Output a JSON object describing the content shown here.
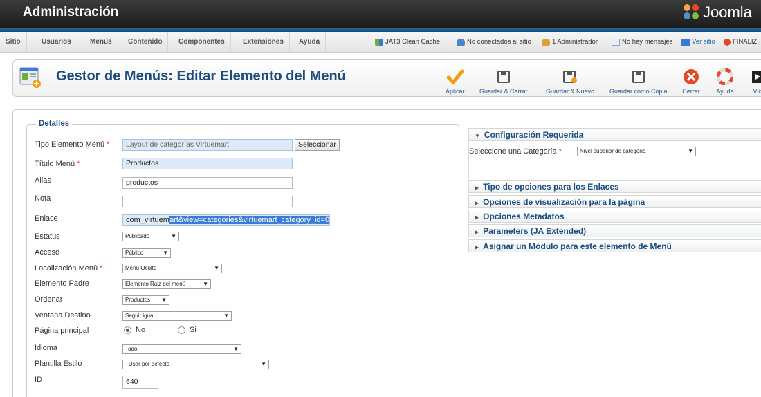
{
  "header": {
    "title": "Administración",
    "brand": "Joomla"
  },
  "menubar": {
    "items": [
      "Sitio",
      "Usuarios",
      "Menús",
      "Contenido",
      "Componentes",
      "Extensiones",
      "Ayuda"
    ],
    "status": {
      "cache": "JAT3 Clean Cache",
      "visitors": "No conectados al sitio",
      "admins": "1 Administrador",
      "messages": "No hay mensajes",
      "view_site": "Ver sitio",
      "logout": "FINALIZ"
    }
  },
  "toolbar": {
    "title": "Gestor de Menús: Editar Elemento del Menú",
    "buttons": {
      "apply": "Aplicar",
      "save_close": "Guardar & Cerrar",
      "save_new": "Guardar & Nuevo",
      "save_copy": "Guardar como Copia",
      "close": "Cerrar",
      "help": "Ayuda",
      "video": "Vid"
    }
  },
  "form": {
    "legend": "Detalles",
    "fields": {
      "tipo": {
        "label": "Tipo Elemento Menú",
        "value": "Layout de categorías Virtuemart",
        "button": "Seleccionar"
      },
      "titulo": {
        "label": "Título Menú",
        "value": "Productos"
      },
      "alias": {
        "label": "Alias",
        "value": "productos"
      },
      "nota": {
        "label": "Nota",
        "value": ""
      },
      "enlace": {
        "label": "Enlace",
        "value_plain": "com_virtuem",
        "value_selected": "art&view=categories&virtuemart_category_id=0"
      },
      "estatus": {
        "label": "Estatus",
        "value": "Publicado"
      },
      "acceso": {
        "label": "Acceso",
        "value": "Público"
      },
      "localizacion": {
        "label": "Localización Menú",
        "value": "Menu Oculto"
      },
      "padre": {
        "label": "Elemento Padre",
        "value": "Elemento Raiz del menú"
      },
      "ordenar": {
        "label": "Ordenar",
        "value": "Productos"
      },
      "ventana": {
        "label": "Ventana Destino",
        "value": "Seguir igual"
      },
      "principal": {
        "label": "Página principal",
        "option_no": "No",
        "option_si": "Si",
        "selected": "No"
      },
      "idioma": {
        "label": "Idioma",
        "value": "Todo"
      },
      "plantilla": {
        "label": "Plantilla Estilo",
        "value": "- Usar por defecto -"
      },
      "id": {
        "label": "ID",
        "value": "640"
      }
    },
    "required_marker": "*"
  },
  "sidebar": {
    "config": {
      "title": "Configuración Requerida",
      "category_label": "Seleccione una Categoría",
      "category_value": "Nivel superior de categoría"
    },
    "panels": [
      "Tipo de opciones para los Enlaces",
      "Opciones de visualización para la página",
      "Opciones Metadatos",
      "Parameters (JA Extended)",
      "Asignar un Módulo para este elemento de Menú"
    ]
  },
  "colors": {
    "title_blue": "#1c4d7c",
    "required_red": "#e6472b",
    "header_dark": "#2a2a2a",
    "accent_blue": "#2a6aa3"
  }
}
